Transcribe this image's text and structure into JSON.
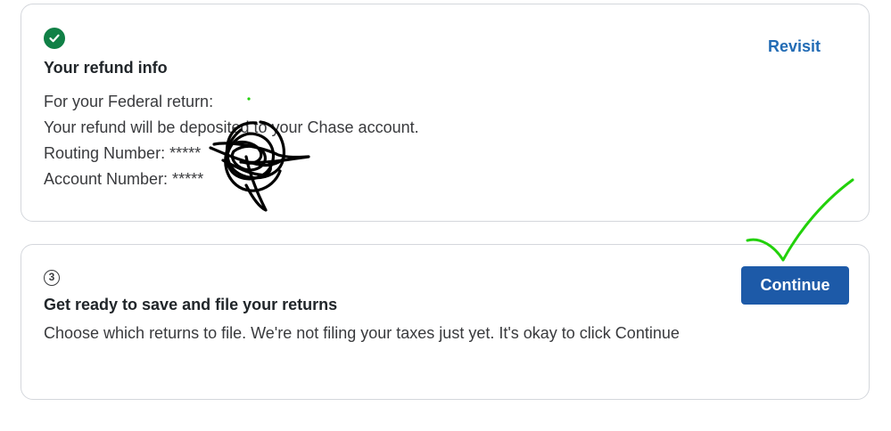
{
  "refund_card": {
    "title": "Your refund info",
    "action_label": "Revisit",
    "lines": [
      "For your Federal return:",
      "Your refund will be deposited to your Chase account.",
      "Routing Number: *****",
      "Account Number: *****"
    ]
  },
  "file_card": {
    "step_number": "3",
    "title": "Get ready to save and file your returns",
    "description": "Choose which returns to file. We're not filing your taxes just yet. It's okay to click Continue",
    "button_label": "Continue"
  },
  "colors": {
    "accent_blue": "#1d5aa8",
    "link_blue": "#236cb5",
    "success_green": "#108046",
    "annotation_green": "#22d10a",
    "scribble_black": "#000000"
  }
}
